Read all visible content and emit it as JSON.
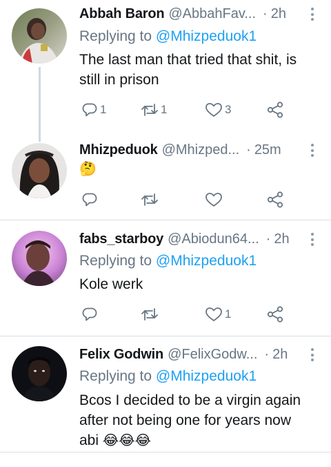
{
  "tweets": [
    {
      "name": "Abbah Baron",
      "handle": "@AbbahFav...",
      "dot": "·",
      "time": "2h",
      "replying_prefix": "Replying to",
      "replying_to": "@Mhizpeduok1",
      "text_lines": [
        "The last man that tried that shit, is",
        "still in prison"
      ],
      "emoji": "",
      "counts": {
        "reply": "1",
        "retweet": "1",
        "like": "3"
      }
    },
    {
      "name": "Mhizpeduok",
      "handle": "@Mhizped...",
      "dot": "·",
      "time": "25m",
      "replying_prefix": "",
      "replying_to": "",
      "text_lines": [],
      "emoji": "🤔",
      "counts": {
        "reply": "",
        "retweet": "",
        "like": ""
      }
    },
    {
      "name": "fabs_starboy",
      "handle": "@Abiodun64...",
      "dot": "·",
      "time": "2h",
      "replying_prefix": "Replying to",
      "replying_to": "@Mhizpeduok1",
      "text_lines": [
        "Kole werk"
      ],
      "emoji": "",
      "counts": {
        "reply": "",
        "retweet": "",
        "like": "1"
      }
    },
    {
      "name": "Felix Godwin",
      "handle": "@FelixGodw...",
      "dot": "·",
      "time": "2h",
      "replying_prefix": "Replying to",
      "replying_to": "@Mhizpeduok1",
      "text_lines": [
        "Bcos I decided to be a virgin again",
        "after not being one for years now",
        "abi"
      ],
      "emoji": "😂😂😂",
      "counts": {
        "reply": "",
        "retweet": "",
        "like": ""
      }
    }
  ],
  "icons": {
    "reply": "reply-icon",
    "retweet": "retweet-icon",
    "like": "like-icon",
    "share": "share-icon",
    "more": "more-icon"
  },
  "colors": {
    "text": "#14171a",
    "muted": "#687684",
    "accent": "#1da1f2",
    "divider": "#d8dfe4",
    "thread_line": "#cfd9de"
  }
}
